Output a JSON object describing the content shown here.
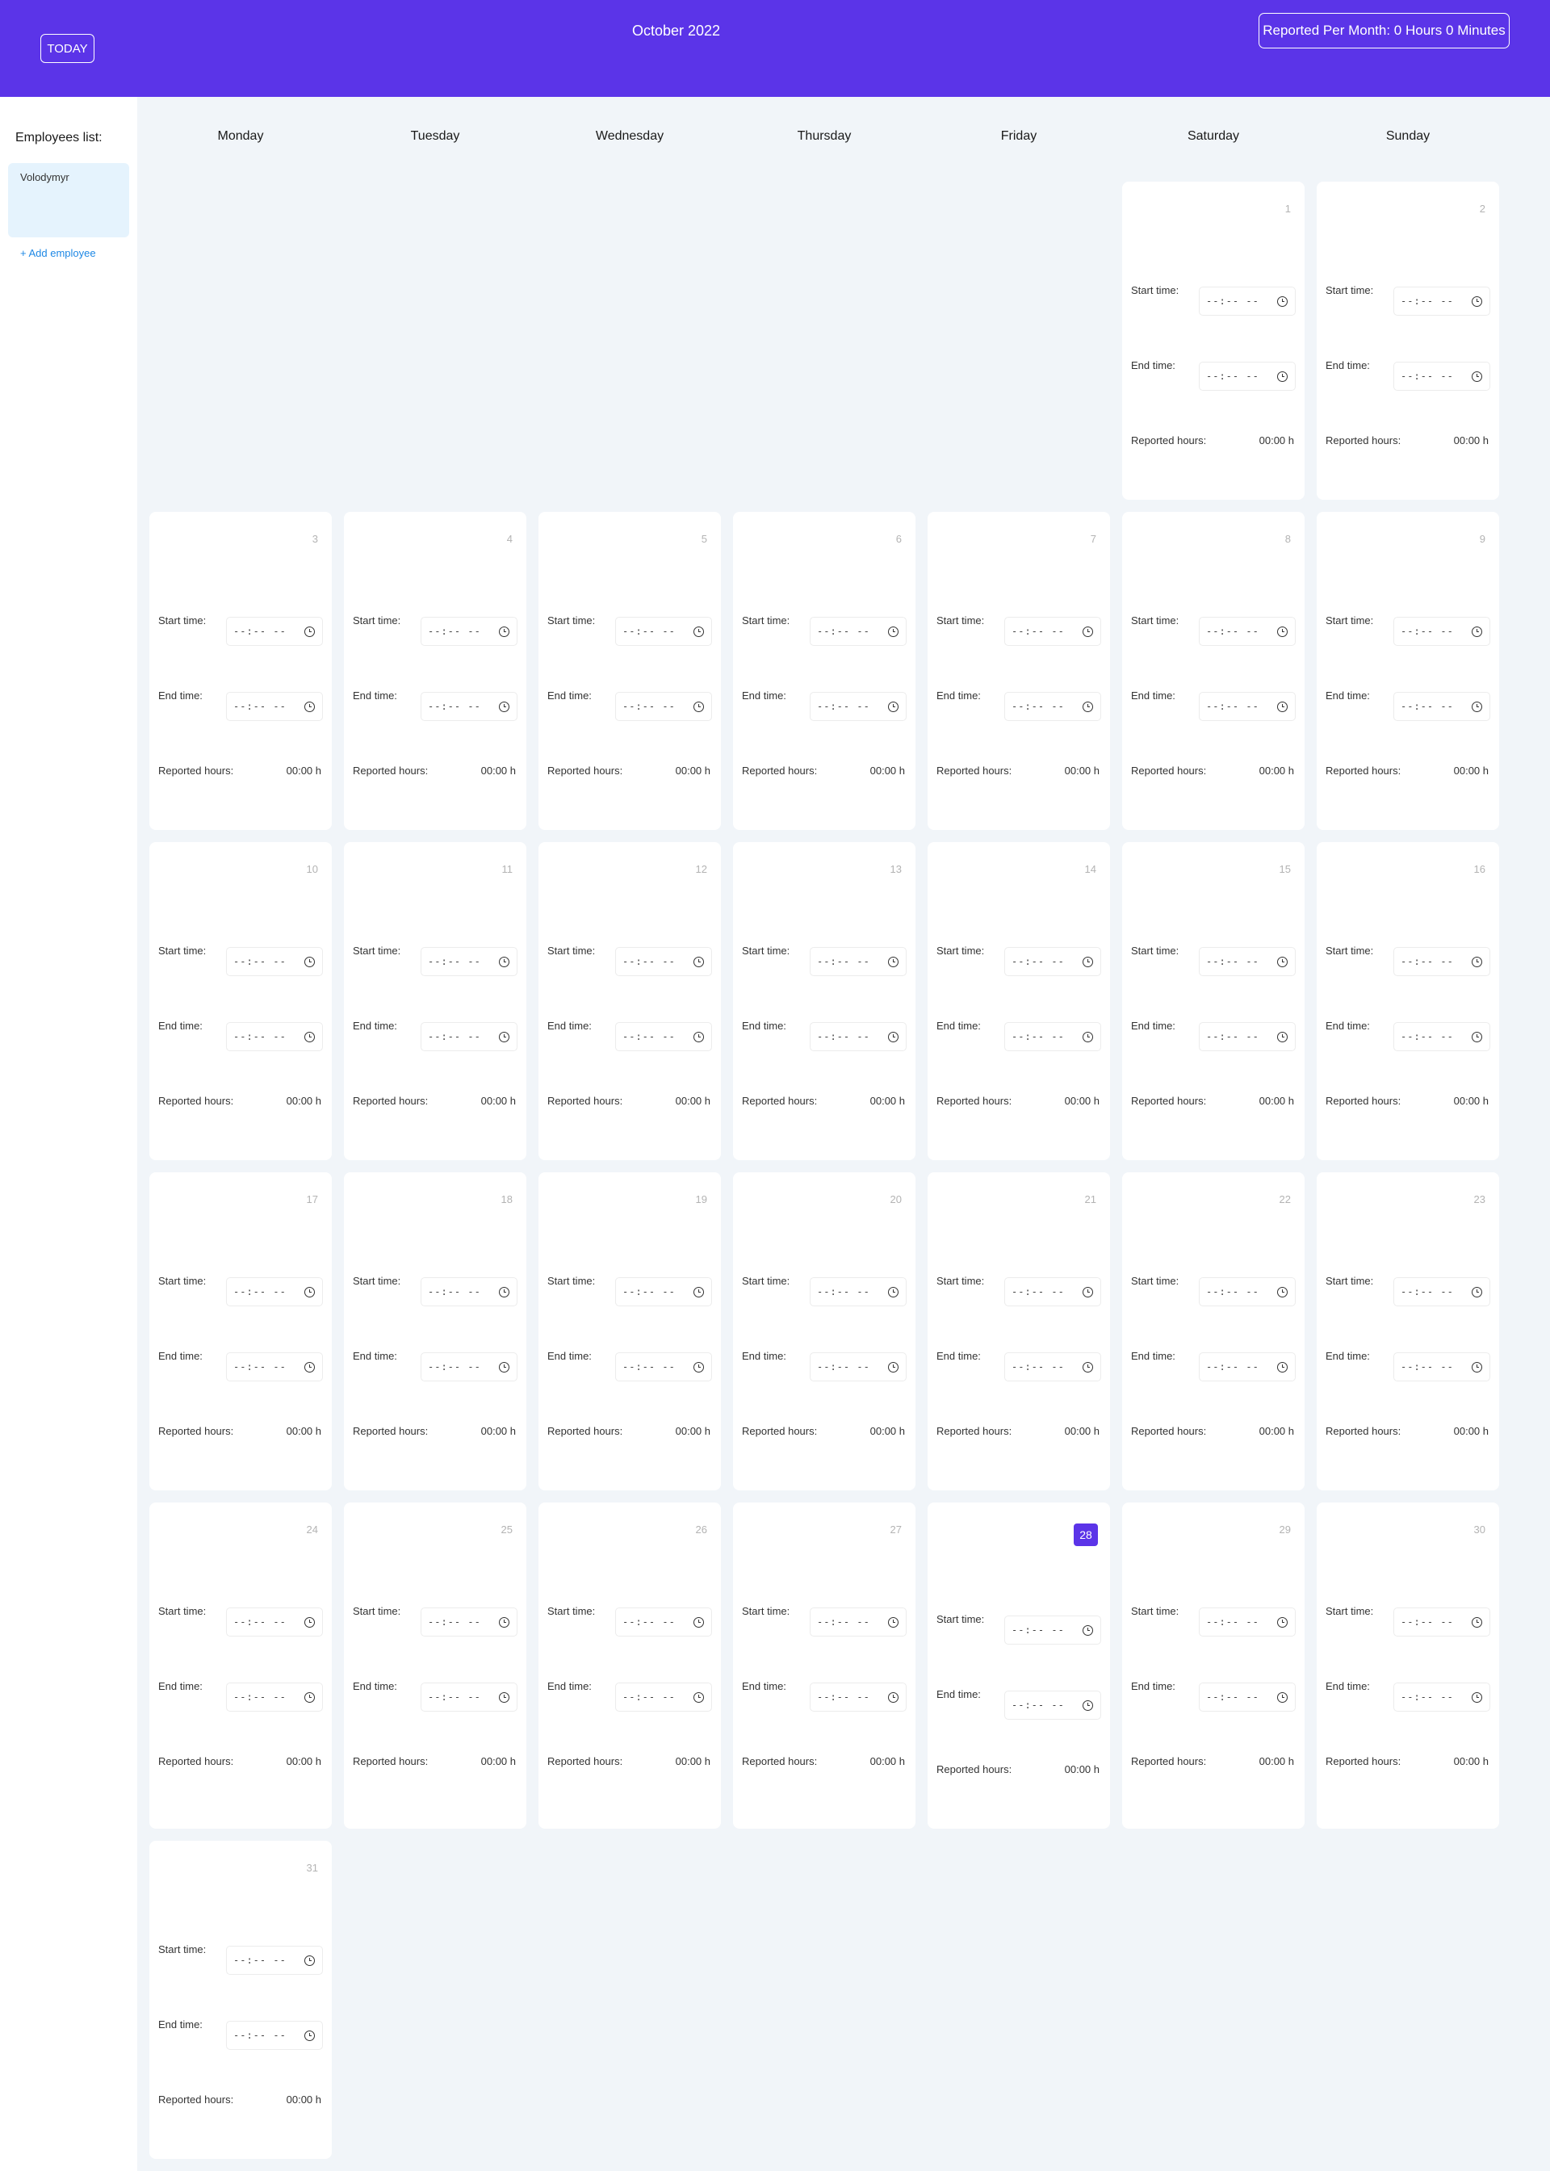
{
  "header": {
    "today_label": "TODAY",
    "month_title": "October 2022",
    "reported_per_month": "Reported Per Month: 0 Hours 0 Minutes",
    "background_color": "#5b34e8"
  },
  "sidebar": {
    "title": "Employees list:",
    "employees": [
      {
        "name": "Volodymyr"
      }
    ],
    "add_employee_label": "+ Add employee"
  },
  "weekdays": [
    "Monday",
    "Tuesday",
    "Wednesday",
    "Thursday",
    "Friday",
    "Saturday",
    "Sunday"
  ],
  "labels": {
    "start_time": "Start time:",
    "end_time": "End time:",
    "reported_hours": "Reported hours:",
    "time_placeholder": "--:-- --"
  },
  "calendar": {
    "first_weekday_index": 5,
    "today": 28,
    "days": [
      {
        "day": "1",
        "hours": "00:00 h"
      },
      {
        "day": "2",
        "hours": "00:00 h"
      },
      {
        "day": "3",
        "hours": "00:00 h"
      },
      {
        "day": "4",
        "hours": "00:00 h"
      },
      {
        "day": "5",
        "hours": "00:00 h"
      },
      {
        "day": "6",
        "hours": "00:00 h"
      },
      {
        "day": "7",
        "hours": "00:00 h"
      },
      {
        "day": "8",
        "hours": "00:00 h"
      },
      {
        "day": "9",
        "hours": "00:00 h"
      },
      {
        "day": "10",
        "hours": "00:00 h"
      },
      {
        "day": "11",
        "hours": "00:00 h"
      },
      {
        "day": "12",
        "hours": "00:00 h"
      },
      {
        "day": "13",
        "hours": "00:00 h"
      },
      {
        "day": "14",
        "hours": "00:00 h"
      },
      {
        "day": "15",
        "hours": "00:00 h"
      },
      {
        "day": "16",
        "hours": "00:00 h"
      },
      {
        "day": "17",
        "hours": "00:00 h"
      },
      {
        "day": "18",
        "hours": "00:00 h"
      },
      {
        "day": "19",
        "hours": "00:00 h"
      },
      {
        "day": "20",
        "hours": "00:00 h"
      },
      {
        "day": "21",
        "hours": "00:00 h"
      },
      {
        "day": "22",
        "hours": "00:00 h"
      },
      {
        "day": "23",
        "hours": "00:00 h"
      },
      {
        "day": "24",
        "hours": "00:00 h"
      },
      {
        "day": "25",
        "hours": "00:00 h"
      },
      {
        "day": "26",
        "hours": "00:00 h"
      },
      {
        "day": "27",
        "hours": "00:00 h"
      },
      {
        "day": "28",
        "hours": "00:00 h"
      },
      {
        "day": "29",
        "hours": "00:00 h"
      },
      {
        "day": "30",
        "hours": "00:00 h"
      },
      {
        "day": "31",
        "hours": "00:00 h"
      }
    ]
  }
}
